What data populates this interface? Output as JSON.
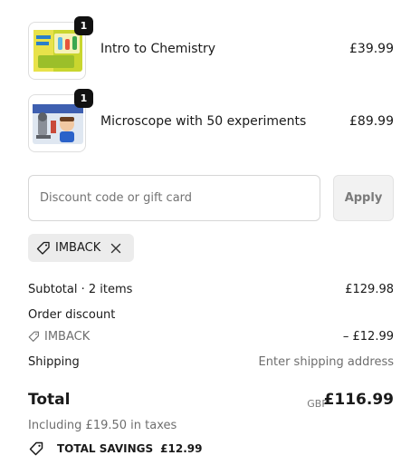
{
  "items": [
    {
      "name": "Intro to Chemistry",
      "quantity": "1",
      "price": "£39.99",
      "thumbnail_icon": "chemistry-kit-box-image"
    },
    {
      "name": "Microscope with 50 experiments",
      "quantity": "1",
      "price": "£89.99",
      "thumbnail_icon": "microscope-kit-box-image"
    }
  ],
  "discount": {
    "placeholder": "Discount code or gift card",
    "value": "",
    "apply_label": "Apply",
    "applied_code": "IMBACK",
    "icon": "tag-icon",
    "remove_icon": "close-icon"
  },
  "summary": {
    "subtotal_label": "Subtotal · 2 items",
    "subtotal_value": "£129.98",
    "order_discount_label": "Order discount",
    "discount_code": "IMBACK",
    "discount_value": "– £12.99",
    "shipping_label": "Shipping",
    "shipping_value": "Enter shipping address",
    "total_label": "Total",
    "currency": "GBP",
    "total_value": "£116.99",
    "taxes_note": "Including £19.50 in taxes",
    "savings_label": "TOTAL SAVINGS",
    "savings_value": "£12.99"
  },
  "colors": {
    "text": "#1a1a1a",
    "muted": "#6e6e6e",
    "badge": "#111111",
    "chip_bg": "#ececec",
    "apply_bg": "#f2f2f2"
  }
}
